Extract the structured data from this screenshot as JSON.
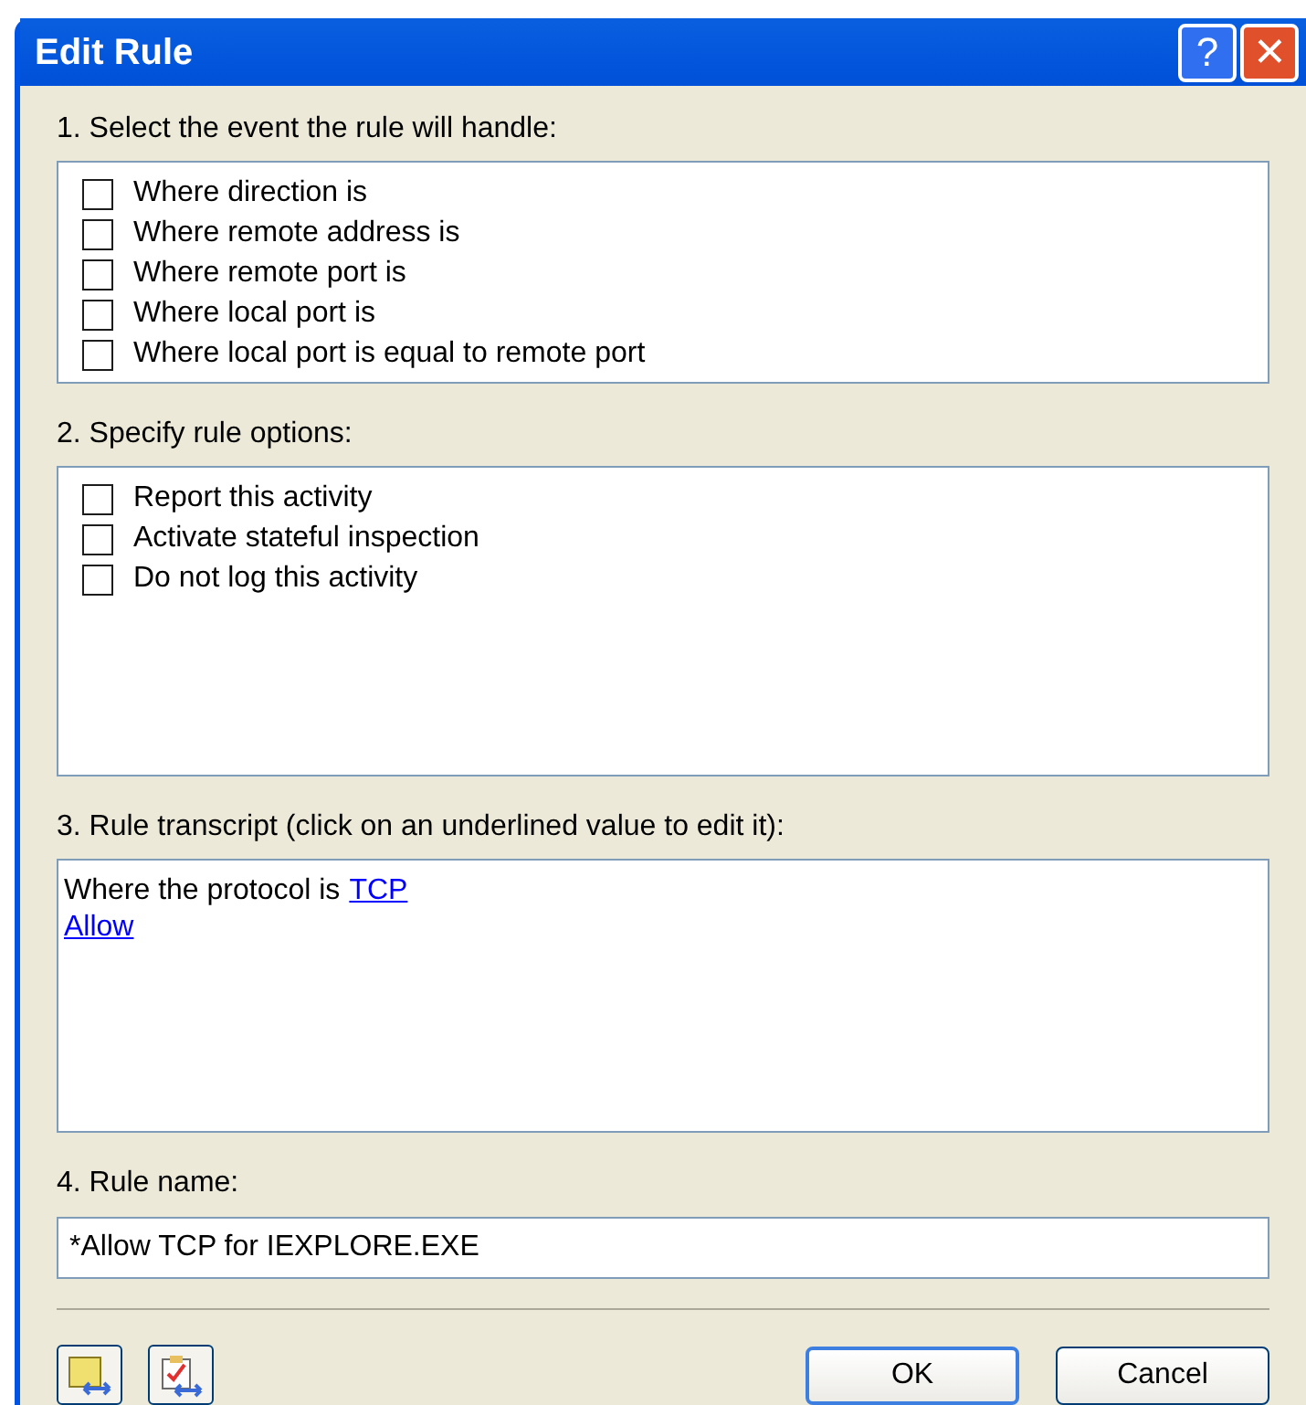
{
  "window": {
    "title": "Edit Rule",
    "buttons": [
      "?",
      "✕"
    ]
  },
  "events": {
    "label": "1. Select the event the rule will handle:",
    "items": [
      {
        "label": "Where direction is",
        "checked": false
      },
      {
        "label": "Where remote address is",
        "checked": false
      },
      {
        "label": "Where remote port is",
        "checked": false
      },
      {
        "label": "Where local port is",
        "checked": false
      },
      {
        "label": "Where local port is equal to remote port",
        "checked": false
      }
    ]
  },
  "options": {
    "label": "2. Specify rule options:",
    "items": [
      {
        "label": "Report this activity",
        "checked": false
      },
      {
        "label": "Activate stateful inspection",
        "checked": false
      },
      {
        "label": "Do not log this activity",
        "checked": false
      }
    ]
  },
  "transcript": {
    "label": "3. Rule transcript (click on an underlined value to edit it):",
    "lines": [
      [
        {
          "kind": "text",
          "text": "Where the protocol is"
        },
        {
          "kind": "link",
          "text": "TCP"
        }
      ],
      [
        {
          "kind": "link",
          "text": "Allow"
        }
      ]
    ]
  },
  "rule_name": {
    "label": "4. Rule name:",
    "value": "*Allow TCP for IEXPLORE.EXE"
  },
  "buttons": [
    "OK",
    "Cancel"
  ]
}
